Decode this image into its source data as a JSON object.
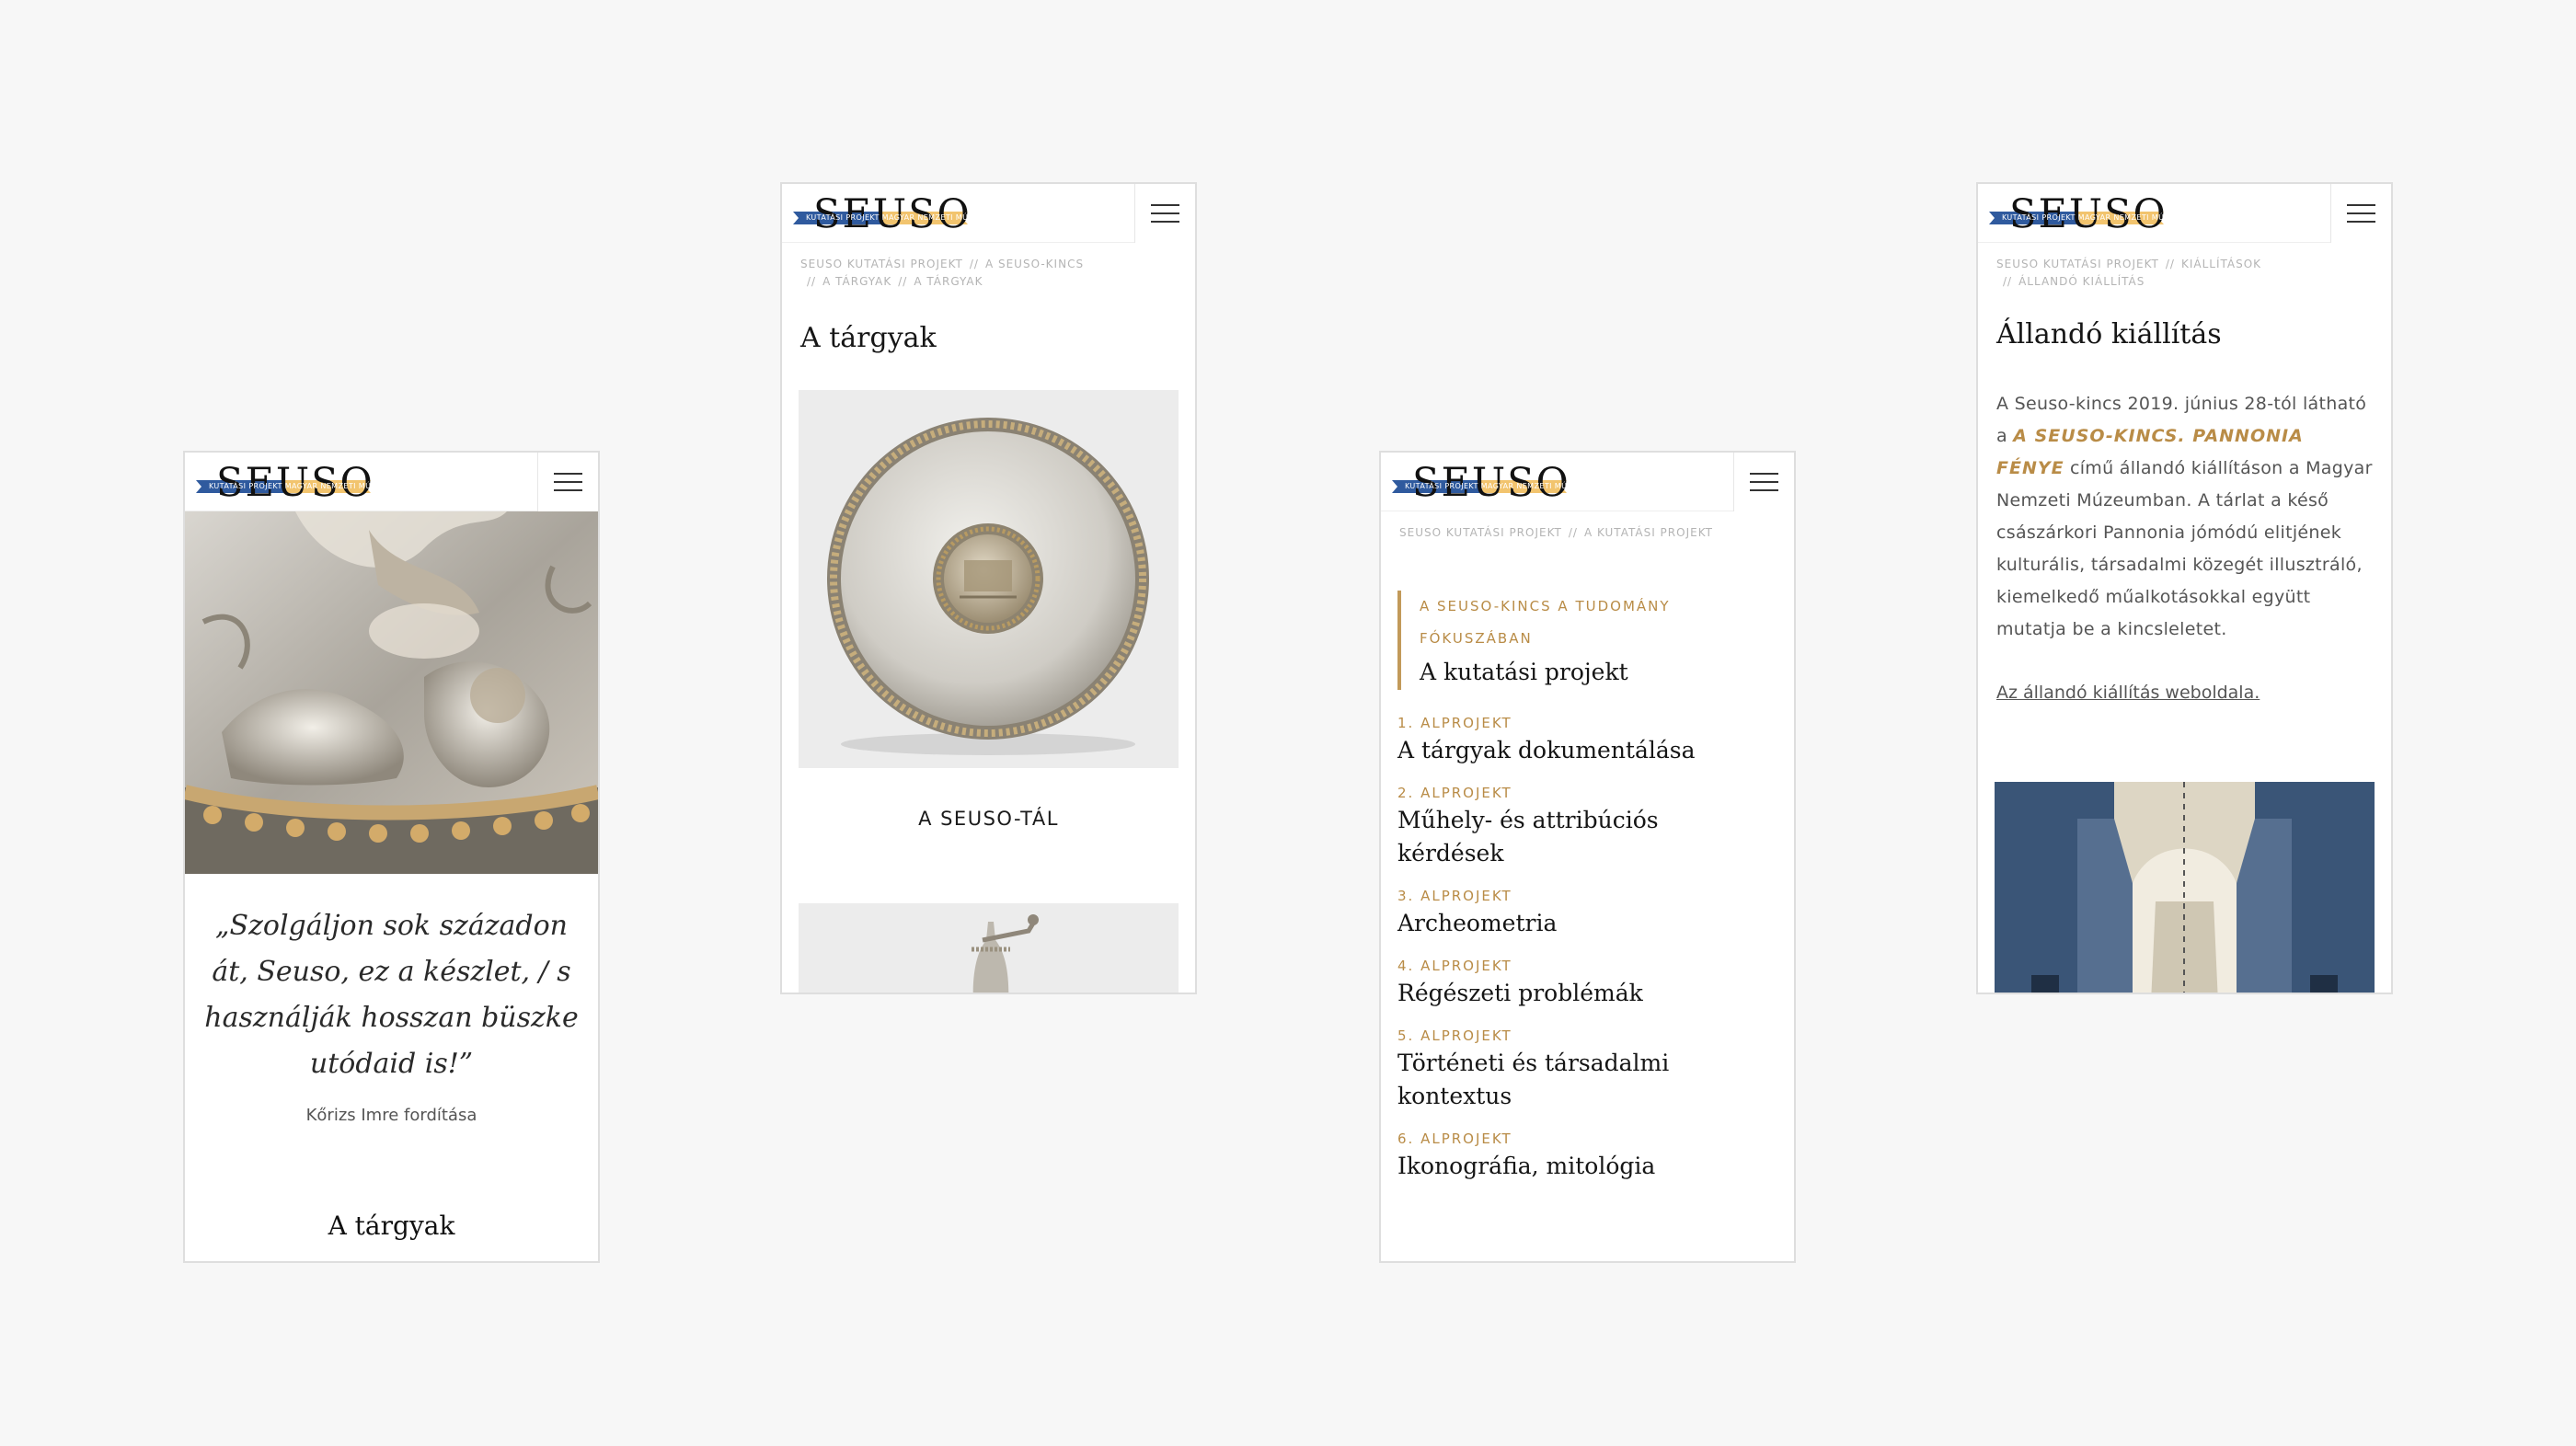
{
  "logo": {
    "wordmark": "SEUSO",
    "ribbon_text": "KUTATÁSI PROJEKT MAGYAR NEMZETI MÚZEUM",
    "colors": {
      "blue": "#2f5a9e",
      "gold": "#f2c46e"
    }
  },
  "menu_icon": "hamburger-menu-icon",
  "phone1": {
    "quote": "„Szolgáljon sok századon át, Seuso, ez a készlet, / s használják hosszan büszke utódaid is!”",
    "quote_credit": "Kőrizs Imre fordítása",
    "section_title": "A tárgyak"
  },
  "phone2": {
    "breadcrumb": [
      "Seuso kutatási projekt",
      "A Seuso-kincs",
      "A tárgyak",
      "A tárgyak"
    ],
    "title": "A tárgyak",
    "card_label": "A SEUSO-TÁL"
  },
  "phone3": {
    "breadcrumb": [
      "Seuso kutatási projekt",
      "A kutatási projekt"
    ],
    "eyebrow": "A SEUSO-KINCS A TUDOMÁNY FÓKUSZÁBAN",
    "heading": "A kutatási projekt",
    "subprojects": [
      {
        "num": "1. ALPROJEKT",
        "title": "A tárgyak dokumentálása"
      },
      {
        "num": "2. ALPROJEKT",
        "title": "Műhely- és attribúciós kérdések"
      },
      {
        "num": "3. ALPROJEKT",
        "title": "Archeometria"
      },
      {
        "num": "4. ALPROJEKT",
        "title": "Régészeti problémák"
      },
      {
        "num": "5. ALPROJEKT",
        "title": "Történeti és társadalmi kontextus"
      },
      {
        "num": "6. ALPROJEKT",
        "title": "Ikonográfia, mitológia"
      }
    ]
  },
  "phone4": {
    "breadcrumb": [
      "Seuso kutatási projekt",
      "Kiállítások",
      "Állandó kiállítás"
    ],
    "title": "Állandó kiállítás",
    "text_before": "A Seuso-kincs 2019. június 28-tól látható a ",
    "text_highlight": "A SEUSO-KINCS. PANNONIA FÉNYE",
    "text_after": " című állandó kiállításon a Magyar Nemzeti Múzeumban. A tárlat a késő császárkori Pannonia jómódú elitjének kulturális, társadalmi közegét illusztráló, kiemelkedő műalkotásokkal együtt mutatja be a kincsleletet.",
    "link": "Az állandó kiállítás weboldala."
  }
}
